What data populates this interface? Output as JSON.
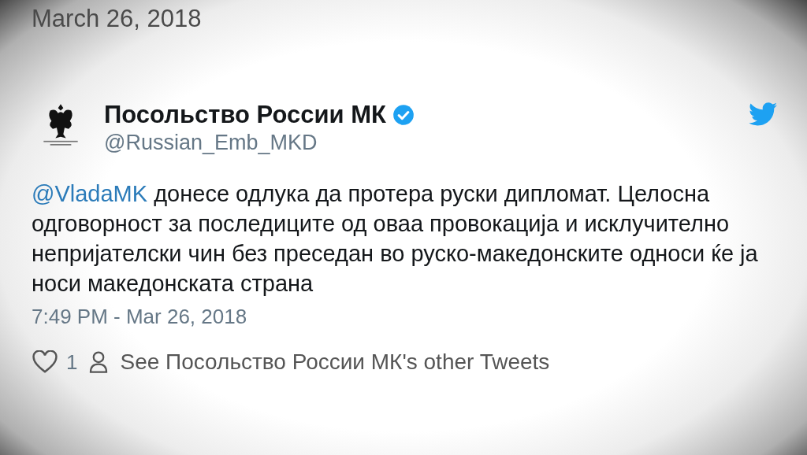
{
  "page_date": "March 26, 2018",
  "tweet": {
    "author": {
      "name": "Посольство России МК",
      "verified": true,
      "handle": "@Russian_Emb_MKD"
    },
    "mention": "@VladaMK",
    "text": "донесе одлука да протера руски дипломат. Целосна одговорност за последиците од оваа провокација и исклучително непријателски чин без преседан во руско-македонските односи ќе ја носи македонската страна",
    "timestamp": "7:49 PM - Mar 26, 2018",
    "likes": "1",
    "other_tweets_link": "See Посольство России МК's other Tweets"
  }
}
